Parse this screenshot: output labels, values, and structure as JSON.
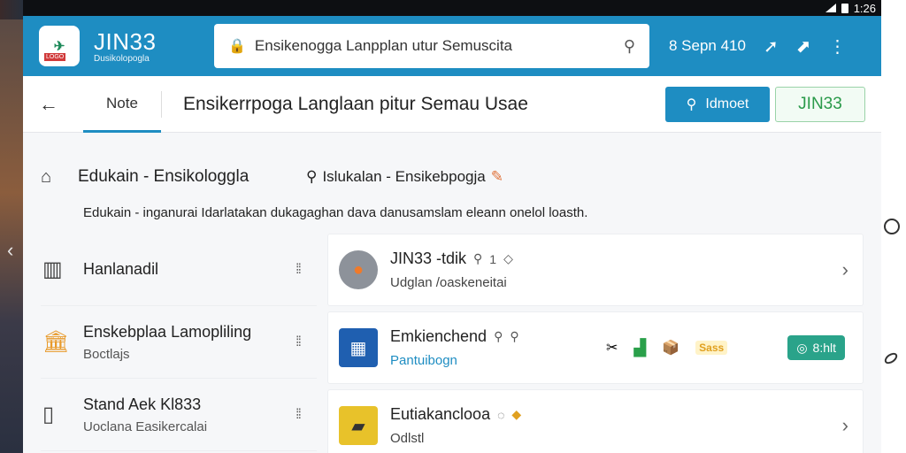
{
  "statusbar": {
    "time": "1:26"
  },
  "header": {
    "brand_name": "JIN33",
    "brand_sub": "Dusikolopogla",
    "logo_tag": "LOGO",
    "search_value": "Ensikenogga Lanpplan utur Semuscita",
    "info_text": "8 Sepn 410",
    "colors": {
      "accent": "#1e8dc2",
      "success": "#2a9a4a"
    }
  },
  "subbar": {
    "tab_label": "Note",
    "title": "Ensikerrpoga Langlaan pitur Semau Usae",
    "primary_button": "Idmoet",
    "outline_button": "JIN33"
  },
  "main": {
    "heading_left": "Edukain - Ensikologgla",
    "heading_right": "Islukalan - Ensikebpogja",
    "description": "Edukain - inganurai Idarlatakan dukagaghan dava danusamslam eleann onelol loasth."
  },
  "left_items": [
    {
      "title": "Hanlanadil",
      "subtitle": "",
      "icon": "columns-icon"
    },
    {
      "title": "Enskebplaa Lamopliling",
      "subtitle": "Boctlajs",
      "icon": "bank-icon"
    },
    {
      "title": "Stand Aek Kl833",
      "subtitle": "Uoclana Easikercalai",
      "icon": "door-icon"
    }
  ],
  "right_items": [
    {
      "title": "JIN33 -tdik",
      "meta": "1",
      "subtitle": "Udglan /oaskeneitai",
      "icon": "orange-ball-icon"
    },
    {
      "title": "Emkienchend",
      "meta": "",
      "subtitle": "Pantuibogn",
      "icon": "box-icon",
      "promo": "Sass",
      "badge": "8:hlt"
    },
    {
      "title": "Eutiakanclooa",
      "meta": "",
      "subtitle": "Odlstl",
      "icon": "truck-icon"
    }
  ]
}
